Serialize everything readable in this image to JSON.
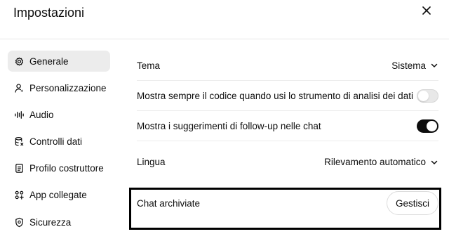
{
  "dialog": {
    "title": "Impostazioni"
  },
  "sidebar": {
    "items": [
      {
        "label": "Generale",
        "icon": "gear-icon",
        "active": true
      },
      {
        "label": "Personalizzazione",
        "icon": "person-icon"
      },
      {
        "label": "Audio",
        "icon": "waveform-icon"
      },
      {
        "label": "Controlli dati",
        "icon": "database-icon"
      },
      {
        "label": "Profilo costruttore",
        "icon": "id-card-icon"
      },
      {
        "label": "App collegate",
        "icon": "apps-icon"
      },
      {
        "label": "Sicurezza",
        "icon": "shield-icon"
      }
    ]
  },
  "settings": {
    "theme": {
      "label": "Tema",
      "value": "Sistema"
    },
    "show_code": {
      "label": "Mostra sempre il codice quando usi lo strumento di analisi dei dati",
      "enabled": false
    },
    "followups": {
      "label": "Mostra i suggerimenti di follow-up nelle chat",
      "enabled": true
    },
    "language": {
      "label": "Lingua",
      "value": "Rilevamento automatico"
    },
    "archived": {
      "label": "Chat archiviate",
      "button": "Gestisci"
    }
  },
  "colors": {
    "active_bg": "#ececec",
    "toggle_on": "#0d0d0d",
    "toggle_off": "#e8e8e8",
    "highlight_border": "#000000"
  }
}
